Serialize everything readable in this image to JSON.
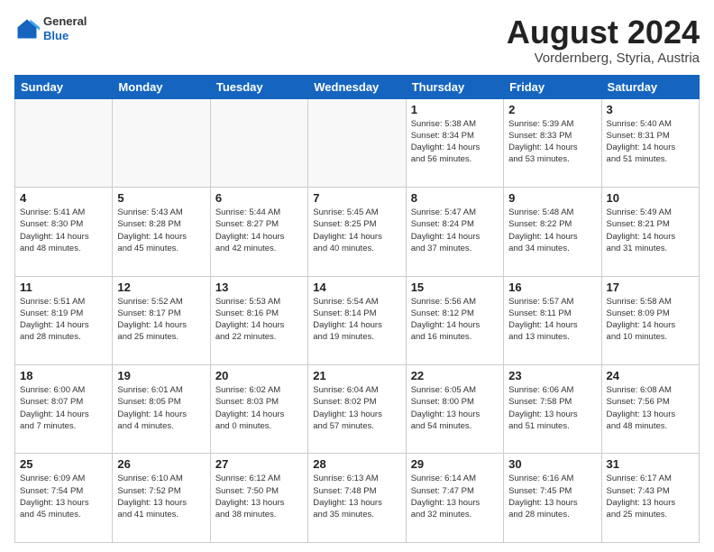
{
  "header": {
    "logo_general": "General",
    "logo_blue": "Blue",
    "month_year": "August 2024",
    "location": "Vordernberg, Styria, Austria"
  },
  "days_of_week": [
    "Sunday",
    "Monday",
    "Tuesday",
    "Wednesday",
    "Thursday",
    "Friday",
    "Saturday"
  ],
  "weeks": [
    [
      {
        "day": "",
        "info": ""
      },
      {
        "day": "",
        "info": ""
      },
      {
        "day": "",
        "info": ""
      },
      {
        "day": "",
        "info": ""
      },
      {
        "day": "1",
        "info": "Sunrise: 5:38 AM\nSunset: 8:34 PM\nDaylight: 14 hours\nand 56 minutes."
      },
      {
        "day": "2",
        "info": "Sunrise: 5:39 AM\nSunset: 8:33 PM\nDaylight: 14 hours\nand 53 minutes."
      },
      {
        "day": "3",
        "info": "Sunrise: 5:40 AM\nSunset: 8:31 PM\nDaylight: 14 hours\nand 51 minutes."
      }
    ],
    [
      {
        "day": "4",
        "info": "Sunrise: 5:41 AM\nSunset: 8:30 PM\nDaylight: 14 hours\nand 48 minutes."
      },
      {
        "day": "5",
        "info": "Sunrise: 5:43 AM\nSunset: 8:28 PM\nDaylight: 14 hours\nand 45 minutes."
      },
      {
        "day": "6",
        "info": "Sunrise: 5:44 AM\nSunset: 8:27 PM\nDaylight: 14 hours\nand 42 minutes."
      },
      {
        "day": "7",
        "info": "Sunrise: 5:45 AM\nSunset: 8:25 PM\nDaylight: 14 hours\nand 40 minutes."
      },
      {
        "day": "8",
        "info": "Sunrise: 5:47 AM\nSunset: 8:24 PM\nDaylight: 14 hours\nand 37 minutes."
      },
      {
        "day": "9",
        "info": "Sunrise: 5:48 AM\nSunset: 8:22 PM\nDaylight: 14 hours\nand 34 minutes."
      },
      {
        "day": "10",
        "info": "Sunrise: 5:49 AM\nSunset: 8:21 PM\nDaylight: 14 hours\nand 31 minutes."
      }
    ],
    [
      {
        "day": "11",
        "info": "Sunrise: 5:51 AM\nSunset: 8:19 PM\nDaylight: 14 hours\nand 28 minutes."
      },
      {
        "day": "12",
        "info": "Sunrise: 5:52 AM\nSunset: 8:17 PM\nDaylight: 14 hours\nand 25 minutes."
      },
      {
        "day": "13",
        "info": "Sunrise: 5:53 AM\nSunset: 8:16 PM\nDaylight: 14 hours\nand 22 minutes."
      },
      {
        "day": "14",
        "info": "Sunrise: 5:54 AM\nSunset: 8:14 PM\nDaylight: 14 hours\nand 19 minutes."
      },
      {
        "day": "15",
        "info": "Sunrise: 5:56 AM\nSunset: 8:12 PM\nDaylight: 14 hours\nand 16 minutes."
      },
      {
        "day": "16",
        "info": "Sunrise: 5:57 AM\nSunset: 8:11 PM\nDaylight: 14 hours\nand 13 minutes."
      },
      {
        "day": "17",
        "info": "Sunrise: 5:58 AM\nSunset: 8:09 PM\nDaylight: 14 hours\nand 10 minutes."
      }
    ],
    [
      {
        "day": "18",
        "info": "Sunrise: 6:00 AM\nSunset: 8:07 PM\nDaylight: 14 hours\nand 7 minutes."
      },
      {
        "day": "19",
        "info": "Sunrise: 6:01 AM\nSunset: 8:05 PM\nDaylight: 14 hours\nand 4 minutes."
      },
      {
        "day": "20",
        "info": "Sunrise: 6:02 AM\nSunset: 8:03 PM\nDaylight: 14 hours\nand 0 minutes."
      },
      {
        "day": "21",
        "info": "Sunrise: 6:04 AM\nSunset: 8:02 PM\nDaylight: 13 hours\nand 57 minutes."
      },
      {
        "day": "22",
        "info": "Sunrise: 6:05 AM\nSunset: 8:00 PM\nDaylight: 13 hours\nand 54 minutes."
      },
      {
        "day": "23",
        "info": "Sunrise: 6:06 AM\nSunset: 7:58 PM\nDaylight: 13 hours\nand 51 minutes."
      },
      {
        "day": "24",
        "info": "Sunrise: 6:08 AM\nSunset: 7:56 PM\nDaylight: 13 hours\nand 48 minutes."
      }
    ],
    [
      {
        "day": "25",
        "info": "Sunrise: 6:09 AM\nSunset: 7:54 PM\nDaylight: 13 hours\nand 45 minutes."
      },
      {
        "day": "26",
        "info": "Sunrise: 6:10 AM\nSunset: 7:52 PM\nDaylight: 13 hours\nand 41 minutes."
      },
      {
        "day": "27",
        "info": "Sunrise: 6:12 AM\nSunset: 7:50 PM\nDaylight: 13 hours\nand 38 minutes."
      },
      {
        "day": "28",
        "info": "Sunrise: 6:13 AM\nSunset: 7:48 PM\nDaylight: 13 hours\nand 35 minutes."
      },
      {
        "day": "29",
        "info": "Sunrise: 6:14 AM\nSunset: 7:47 PM\nDaylight: 13 hours\nand 32 minutes."
      },
      {
        "day": "30",
        "info": "Sunrise: 6:16 AM\nSunset: 7:45 PM\nDaylight: 13 hours\nand 28 minutes."
      },
      {
        "day": "31",
        "info": "Sunrise: 6:17 AM\nSunset: 7:43 PM\nDaylight: 13 hours\nand 25 minutes."
      }
    ]
  ]
}
